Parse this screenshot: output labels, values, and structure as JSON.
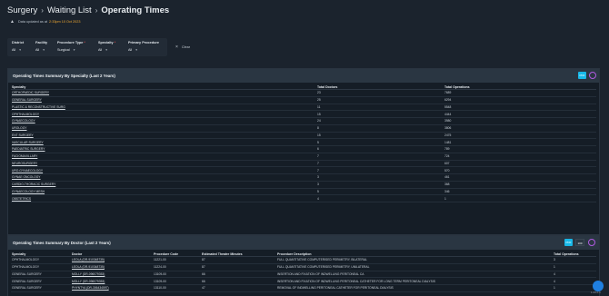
{
  "breadcrumb": {
    "items": [
      "Surgery",
      "Waiting List"
    ],
    "current": "Operating Times"
  },
  "updated": {
    "prefix": "Data updated as at",
    "time": "2:33pm 10 Oct 2023"
  },
  "filters": [
    {
      "label": "District",
      "value": "All",
      "required": false
    },
    {
      "label": "Facility",
      "value": "All",
      "required": false
    },
    {
      "label": "Procedure Type",
      "value": "Surgical",
      "required": true
    },
    {
      "label": "Specialty",
      "value": "All",
      "required": true
    },
    {
      "label": "Primary Procedure",
      "value": "All",
      "required": false
    }
  ],
  "clear_label": "Clear",
  "specialty_panel": {
    "title": "Operating Times Summary By Specialty (Last 2 Years)",
    "pdf_label": "PDF",
    "columns": [
      "Specialty",
      "Total Doctors",
      "Total Operations"
    ],
    "rows": [
      [
        "ORTHOPAEDIC SURGERY",
        "23",
        "7689"
      ],
      [
        "GENERAL SURGERY",
        "25",
        "6294"
      ],
      [
        "PLASTIC & RECONSTRUCTIVE SURG",
        "11",
        "5548"
      ],
      [
        "OPHTHALMOLOGY",
        "15",
        "4444"
      ],
      [
        "GYNAECOLOGY",
        "24",
        "3980"
      ],
      [
        "UROLOGY",
        "8",
        "3806"
      ],
      [
        "ENT SURGERY",
        "15",
        "2475"
      ],
      [
        "VASCULAR SURGERY",
        "5",
        "1481"
      ],
      [
        "PAEDIATRIC SURGERY",
        "6",
        "789"
      ],
      [
        "FACIOMAXILLARY",
        "7",
        "724"
      ],
      [
        "NEUROSURGERY",
        "7",
        "607"
      ],
      [
        "URO-GYNAECOLOGY",
        "7",
        "570"
      ],
      [
        "GYNAE ONCOLOGY",
        "3",
        "461"
      ],
      [
        "CARDIO-THORACIC SURGERY",
        "3",
        "368"
      ],
      [
        "GYNAECOLOGY MESH",
        "5",
        "346"
      ],
      [
        "OBSTETRICS",
        "4",
        "1"
      ]
    ]
  },
  "doctor_panel": {
    "title": "Operating Times Summary By Doctor (Last 2 Years)",
    "pdf_label": "PDF",
    "page_size": "100",
    "columns": [
      "Specialty",
      "Doctor",
      "Procedure Code",
      "Estimated Theatre Minutes",
      "Procedure Description",
      "Total Operations"
    ],
    "rows": [
      [
        "OPHTHALMOLOGY",
        "LEOLA (DR-910348735)",
        "11221-00",
        "87",
        "FULL QUANTITATIVE COMPUTERISED PERIMETRY, BILATERAL",
        "3"
      ],
      [
        "OPHTHALMOLOGY",
        "LEOLA (DR-910348735)",
        "11224-00",
        "87",
        "FULL QUANTITATIVE COMPUTERISED PERIMETRY, UNILATERAL",
        "1"
      ],
      [
        "GENERAL SURGERY",
        "MOLLY (DR-096079353)",
        "13109-00",
        "66",
        "INSERTION AND FIXATION OF INDWELLING PERITONEAL CA",
        "4"
      ],
      [
        "GENERAL SURGERY",
        "MOLLY (DR-096079353)",
        "13109-00",
        "66",
        "INSERTION AND FIXATION OF INDWELLING PERITONEAL CATHETER FOR LONG TERM PERITONEAL DIALYSIS",
        "4"
      ],
      [
        "GENERAL SURGERY",
        "PHYNTYA (DR-306434597)",
        "13110-00",
        "47",
        "REMOVAL OF INDWELLING PERITONEAL CATHETER FOR PERITONEAL DIALYSIS",
        "1"
      ]
    ]
  },
  "version": "1.23.0.1"
}
